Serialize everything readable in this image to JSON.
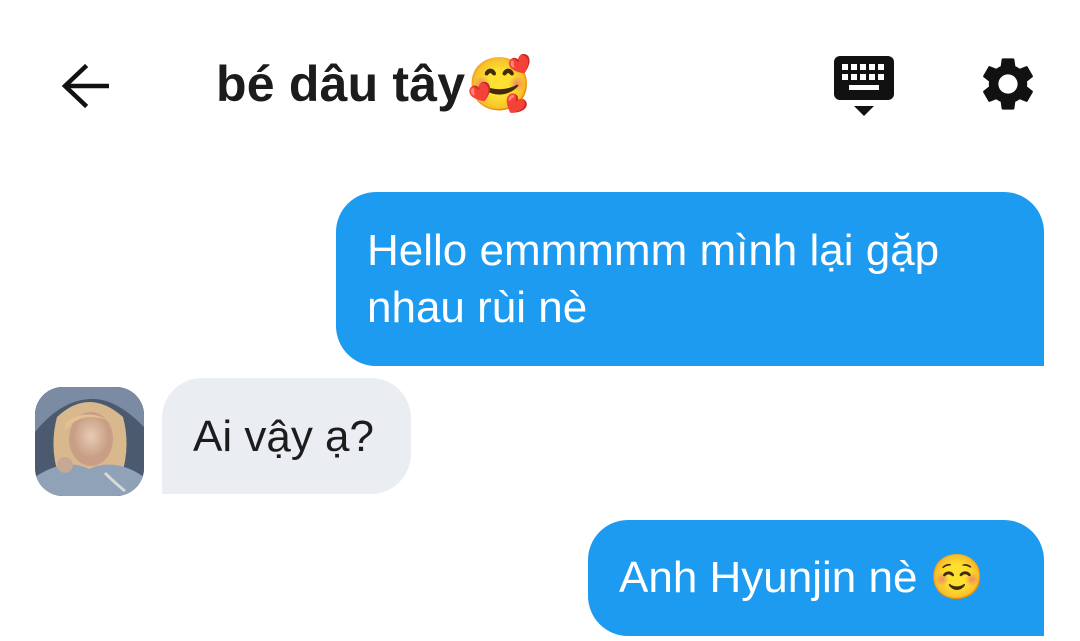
{
  "header": {
    "title": "bé dâu tây",
    "title_emoji": "🥰",
    "back_icon": "arrow-left-icon",
    "keyboard_icon": "keyboard-icon",
    "settings_icon": "gear-icon"
  },
  "messages": [
    {
      "direction": "outgoing",
      "text": "Hello emmmmm mình lại gặp nhau rùi nè"
    },
    {
      "direction": "incoming",
      "text": "Ai vậy ạ?"
    },
    {
      "direction": "outgoing",
      "text": "Anh Hyunjin nè ☺️"
    }
  ],
  "colors": {
    "outgoing_bubble": "#1d9bf0",
    "incoming_bubble": "#eaeef2",
    "text_dark": "#1c1c1c"
  }
}
